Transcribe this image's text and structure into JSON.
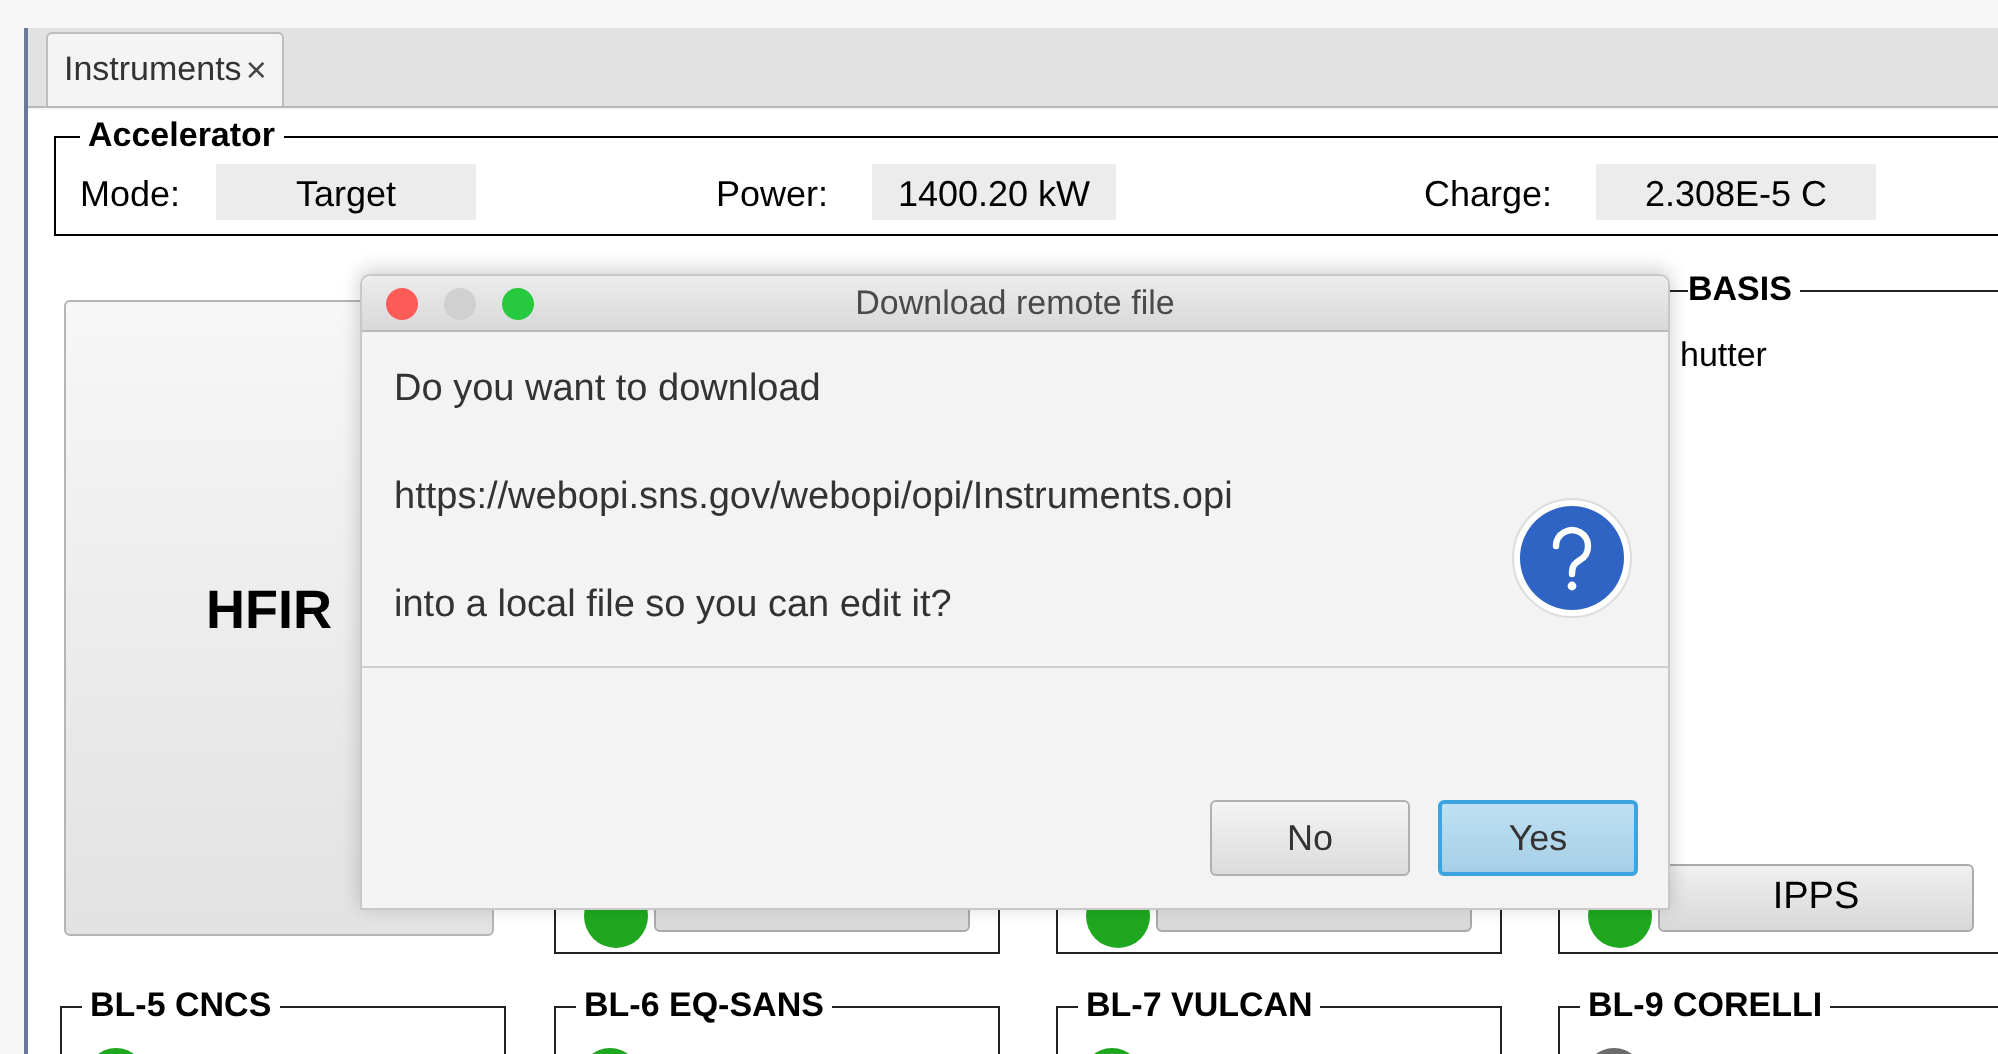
{
  "tabs": [
    {
      "label": "Instruments",
      "close": "×",
      "selected": true
    }
  ],
  "accelerator": {
    "title": "Accelerator",
    "fields": [
      {
        "label": "Mode:",
        "value": "Target"
      },
      {
        "label": "Power:",
        "value": "1400.20 kW"
      },
      {
        "label": "Charge:",
        "value": "2.308E-5 C"
      }
    ]
  },
  "hfir_button": "HFIR",
  "upper_beamlines": [
    {
      "color": "#1fa81f"
    },
    {
      "color": "#1fa81f"
    },
    {
      "title": "BASIS",
      "shutter_label": "hutter",
      "button": "IPPS",
      "color": "#1fa81f"
    }
  ],
  "lower_beamlines": [
    {
      "title": "BL-5 CNCS",
      "color": "#1fa81f"
    },
    {
      "title": "BL-6 EQ-SANS",
      "color": "#1fa81f"
    },
    {
      "title": "BL-7 VULCAN",
      "color": "#1fa81f"
    },
    {
      "title": "BL-9 CORELLI",
      "color": "#6b6b6b"
    }
  ],
  "dialog": {
    "title": "Download remote file",
    "lines": [
      "Do you want to download",
      "https://webopi.sns.gov/webopi/opi/Instruments.opi",
      "into a local file so you can edit it?"
    ],
    "buttons": [
      {
        "label": "No",
        "default": false
      },
      {
        "label": "Yes",
        "default": true
      }
    ]
  }
}
